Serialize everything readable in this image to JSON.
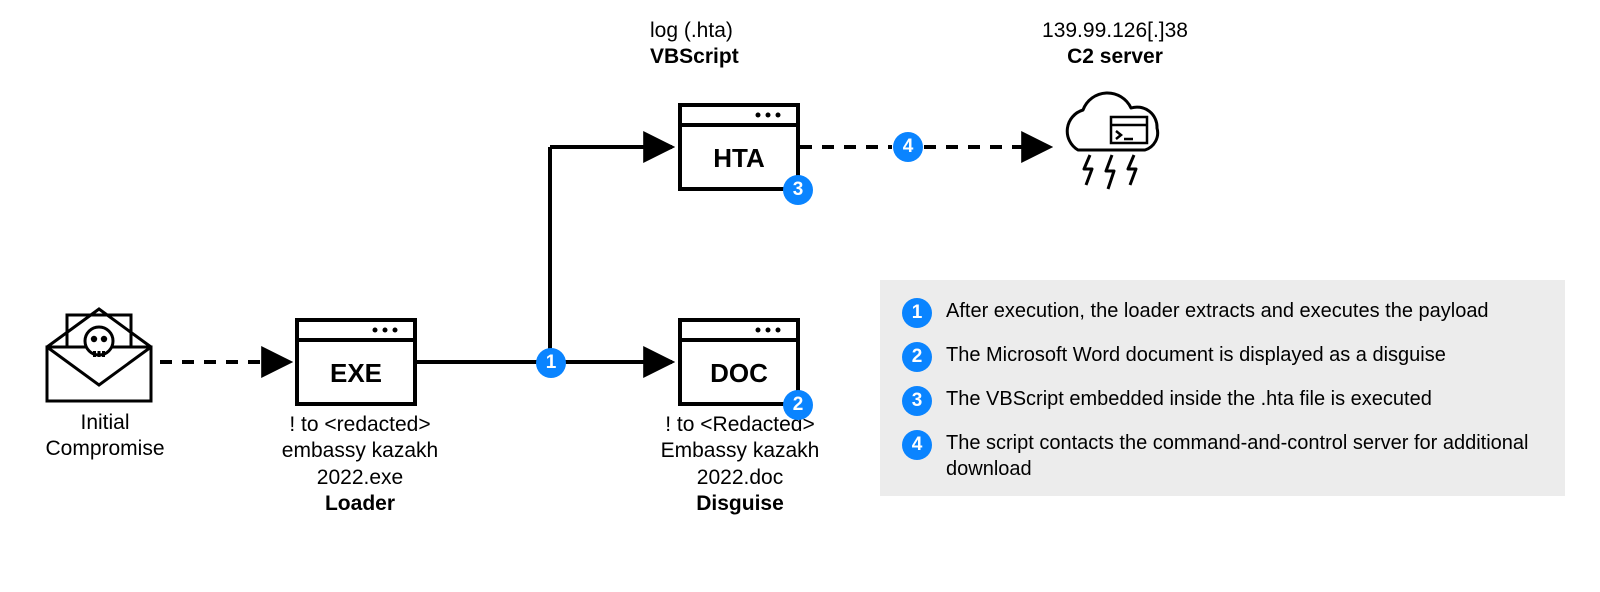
{
  "nodes": {
    "initial": {
      "line1": "Initial",
      "line2": "Compromise"
    },
    "loader": {
      "box_label": "EXE",
      "cap1": "! to <redacted>",
      "cap2": "embassy kazakh",
      "cap3": "2022.exe",
      "role": "Loader"
    },
    "hta": {
      "box_label": "HTA",
      "top1": "log (.hta)",
      "top2": "VBScript"
    },
    "doc": {
      "box_label": "DOC",
      "cap1": "! to <Redacted>",
      "cap2": "Embassy kazakh",
      "cap3": "2022.doc",
      "role": "Disguise"
    },
    "c2": {
      "top1": "139.99.126[.]38",
      "top2": "C2 server"
    }
  },
  "badges": {
    "b1": "1",
    "b2": "2",
    "b3": "3",
    "b4": "4"
  },
  "legend": {
    "i1": {
      "num": "1",
      "text": "After execution, the loader extracts and executes the payload"
    },
    "i2": {
      "num": "2",
      "text": "The Microsoft Word document is displayed as a disguise"
    },
    "i3": {
      "num": "3",
      "text": "The VBScript embedded inside the .hta file is executed"
    },
    "i4": {
      "num": "4",
      "text": "The script contacts the command-and-control server for additional download"
    }
  }
}
